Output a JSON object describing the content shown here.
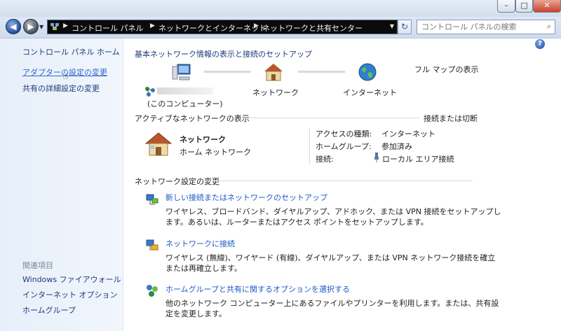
{
  "window": {
    "minimize_glyph": "–",
    "maximize_glyph": "□",
    "close_glyph": "✕"
  },
  "address": {
    "breadcrumbs": [
      "コントロール パネル",
      "ネットワークとインターネット",
      "ネットワークと共有センター"
    ],
    "search_placeholder": "コントロール パネルの検索"
  },
  "sidebar": {
    "items": [
      {
        "label": "コントロール パネル ホーム"
      },
      {
        "label": "アダプターの設定の変更"
      },
      {
        "label": "共有の詳細設定の変更"
      }
    ],
    "related_heading": "関連項目",
    "related": [
      {
        "label": "Windows ファイアウォール"
      },
      {
        "label": "インターネット オプション"
      },
      {
        "label": "ホームグループ"
      }
    ]
  },
  "main": {
    "title": "基本ネットワーク情報の表示と接続のセットアップ",
    "full_map_link": "フル マップの表示",
    "map": {
      "computer_label": "(このコンピューター)",
      "network_label": "ネットワーク",
      "internet_label": "インターネット"
    },
    "active_heading": "アクティブなネットワークの表示",
    "connect_link": "接続または切断",
    "active_network": {
      "name": "ネットワーク",
      "type_link": "ホーム ネットワーク",
      "access_label": "アクセスの種類:",
      "access_value": "インターネット",
      "homegroup_label": "ホームグループ:",
      "homegroup_value": "参加済み",
      "connection_label": "接続:",
      "connection_value": "ローカル エリア接続"
    },
    "settings_heading": "ネットワーク設定の変更",
    "tasks": [
      {
        "title": "新しい接続またはネットワークのセットアップ",
        "desc_lines": [
          "ワイヤレス、ブロードバンド、ダイヤルアップ、アドホック、または VPN 接続をセットアップし",
          "ます。あるいは、ルーターまたはアクセス ポイントをセットアップします。"
        ]
      },
      {
        "title": "ネットワークに接続",
        "desc_lines": [
          "ワイヤレス (無線)、ワイヤード (有線)、ダイヤルアップ、または VPN ネットワーク接続を確立",
          "または再確立します。"
        ]
      },
      {
        "title": "ホームグループと共有に関するオプションを選択する",
        "desc_lines": [
          "他のネットワーク コンピューター上にあるファイルやプリンターを利用します。または、共有設",
          "定を変更します。"
        ]
      }
    ]
  }
}
